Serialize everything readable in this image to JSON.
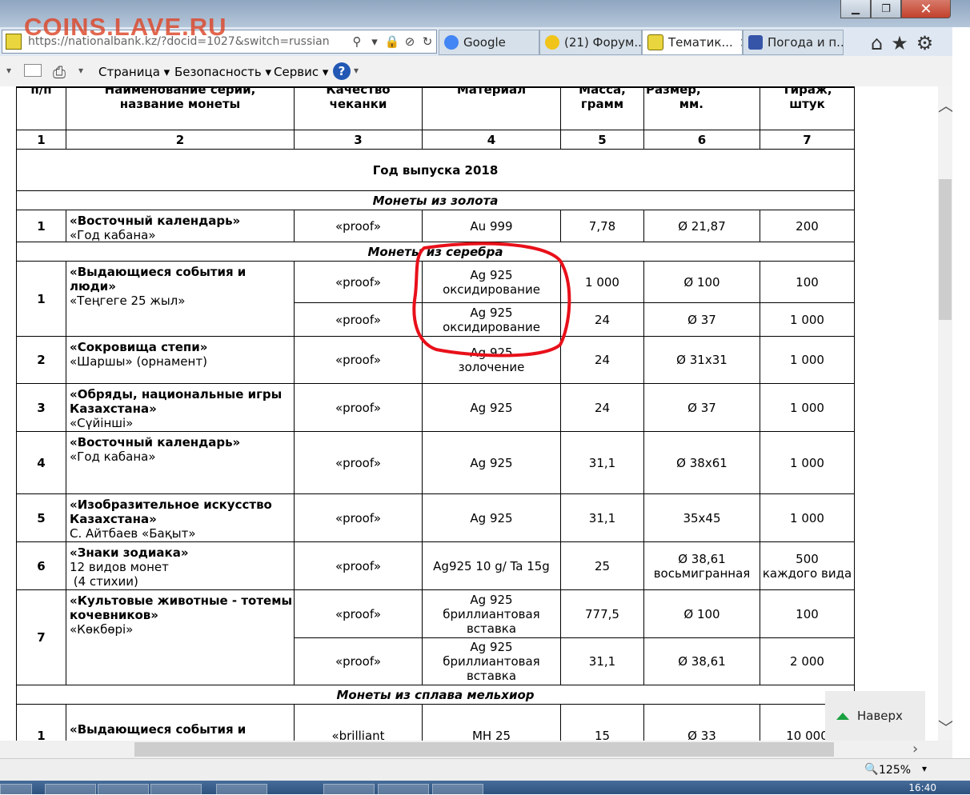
{
  "watermark": "COINS.LAVE.RU",
  "address": {
    "url": "https://nationalbank.kz/?docid=1027&switch=russian"
  },
  "tabs": [
    {
      "label": "Google",
      "active": false
    },
    {
      "label": "(21) Форум...",
      "active": false
    },
    {
      "label": "Тематик...",
      "active": true
    },
    {
      "label": "Погода и п...",
      "active": false
    }
  ],
  "toolbar": {
    "page": "Страница ▾",
    "security": "Безопасность ▾",
    "service": "Сервис ▾",
    "help": "?"
  },
  "table": {
    "headers": [
      "п/п",
      "Наименование серии,\nназвание монеты",
      "Качество\nчеканки",
      "Материал",
      "Масса,\nграмм",
      "Размер,\n        мм.",
      "Тираж,\nштук"
    ],
    "colnums": [
      "1",
      "2",
      "3",
      "4",
      "5",
      "6",
      "7"
    ],
    "year_title": "Год выпуска 2018",
    "section_gold": "Монеты из золота",
    "section_silver": "Монеты из серебра",
    "section_melchior": "Монеты из сплава мельхиор",
    "gold": [
      {
        "n": "1",
        "title": "«Восточный календарь»",
        "sub": "«Год кабана»",
        "quality": "«proof»",
        "material": "Au 999",
        "mass": "7,78",
        "size": "Ø 21,87",
        "mintage": "200"
      }
    ],
    "silver": [
      {
        "n": "1",
        "title": "«Выдающиеся события и люди»",
        "sub": "«Теңгеге 25 жыл»",
        "subrows": [
          {
            "quality": "«proof»",
            "material": "Ag 925\nоксидирование",
            "mass": "1 000",
            "size": "Ø 100",
            "mintage": "100"
          },
          {
            "quality": "«proof»",
            "material": "Ag 925\nоксидирование",
            "mass": "24",
            "size": "Ø 37",
            "mintage": "1 000"
          }
        ]
      },
      {
        "n": "2",
        "title": "«Сокровища степи»",
        "sub": "«Шаршы» (орнамент)",
        "quality": "«proof»",
        "material": "Ag 925\nзолочение",
        "mass": "24",
        "size": "Ø 31x31",
        "mintage": "1 000"
      },
      {
        "n": "3",
        "title": "«Обряды, национальные игры Казахстана»",
        "sub": "«Сүйінші»",
        "quality": "«proof»",
        "material": "Ag 925",
        "mass": "24",
        "size": "Ø 37",
        "mintage": "1 000"
      },
      {
        "n": "4",
        "title": "«Восточный календарь»",
        "sub": "«Год кабана»",
        "quality": "«proof»",
        "material": "Ag 925",
        "mass": "31,1",
        "size": "Ø 38x61",
        "mintage": "1 000"
      },
      {
        "n": "5",
        "title": "«Изобразительное искусство Казахстана»",
        "sub": "С. Айтбаев «Бақыт»",
        "quality": "«proof»",
        "material": "Ag 925",
        "mass": "31,1",
        "size": "35x45",
        "mintage": "1 000"
      },
      {
        "n": "6",
        "title": "«Знаки зодиака»",
        "sub": "12 видов монет\n (4 стихии)",
        "quality": "«proof»",
        "material": "Ag925 10 g/ Ta 15g",
        "mass": "25",
        "size": "Ø 38,61\nвосьмигранная",
        "mintage": "500\nкаждого вида"
      },
      {
        "n": "7",
        "title": "«Культовые животные - тотемы кочевников»",
        "sub": "«Көкбөрі»",
        "subrows": [
          {
            "quality": "«proof»",
            "material": "Ag 925\nбриллиантовая\nвставка",
            "mass": "777,5",
            "size": "Ø 100",
            "mintage": "100"
          },
          {
            "quality": "«proof»",
            "material": "Ag 925\nбриллиантовая\nвставка",
            "mass": "31,1",
            "size": "Ø 38,61",
            "mintage": "2 000"
          }
        ]
      }
    ],
    "melchior": [
      {
        "n": "1",
        "title": "«Выдающиеся события и люди»",
        "quality": "«brilliant",
        "material": "МН 25",
        "mass": "15",
        "size": "Ø 33",
        "mintage": "10 000"
      }
    ]
  },
  "nav_up": "Наверх",
  "status": {
    "zoom": "125%"
  },
  "taskbar": {
    "clock": "16:40"
  },
  "colors": {
    "annotation": "#e8101a",
    "accent_green": "#1aa140"
  }
}
